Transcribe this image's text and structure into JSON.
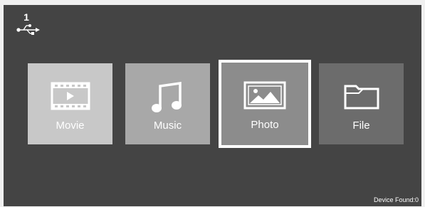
{
  "usb": {
    "count": "1",
    "icon": "usb-icon"
  },
  "tiles": [
    {
      "label": "Movie",
      "icon": "film-icon",
      "color": "#c8c8c8"
    },
    {
      "label": "Music",
      "icon": "music-note-icon",
      "color": "#a8a8a8"
    },
    {
      "label": "Photo",
      "icon": "picture-icon",
      "color": "#8c8c8c",
      "selected": true
    },
    {
      "label": "File",
      "icon": "folder-icon",
      "color": "#6c6c6c"
    }
  ],
  "status": {
    "device_found": "Device Found:0"
  }
}
